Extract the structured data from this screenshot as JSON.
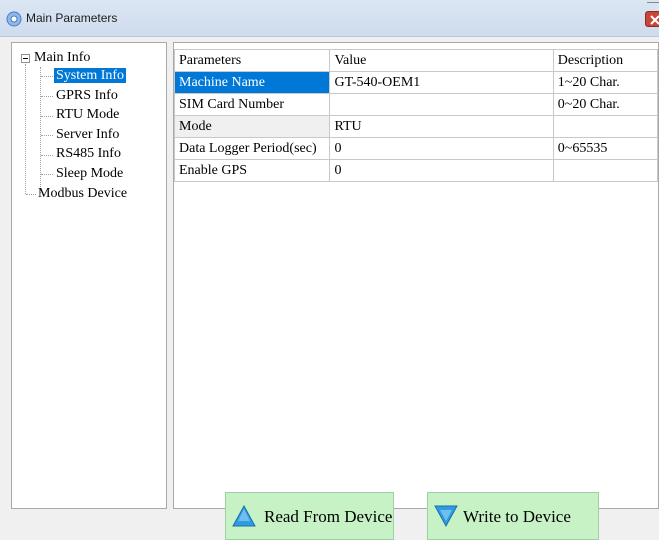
{
  "window": {
    "title": "Main Parameters",
    "close_icon": "close-icon"
  },
  "tree": {
    "root": "Main Info",
    "children": [
      "System Info",
      "GPRS Info",
      "RTU Mode",
      "Server Info",
      "RS485 Info",
      "Sleep Mode"
    ],
    "selected": "System Info",
    "other_root": "Modbus Device"
  },
  "grid": {
    "columns": [
      "Parameters",
      "Value",
      "Description"
    ],
    "rows": [
      {
        "param": "Machine Name",
        "value": "GT-540-OEM1",
        "desc": "1~20 Char."
      },
      {
        "param": "SIM Card Number",
        "value": "",
        "desc": "0~20 Char."
      },
      {
        "param": "Mode",
        "value": "RTU",
        "desc": ""
      },
      {
        "param": "Data Logger Period(sec)",
        "value": "0",
        "desc": "0~65535"
      },
      {
        "param": "Enable GPS",
        "value": "0",
        "desc": ""
      }
    ]
  },
  "buttons": {
    "read": "Read From Device",
    "write": "Write to Device"
  },
  "colors": {
    "selection": "#0078d7",
    "button_bg": "#c6f2c6",
    "arrow": "#2f9be0"
  }
}
